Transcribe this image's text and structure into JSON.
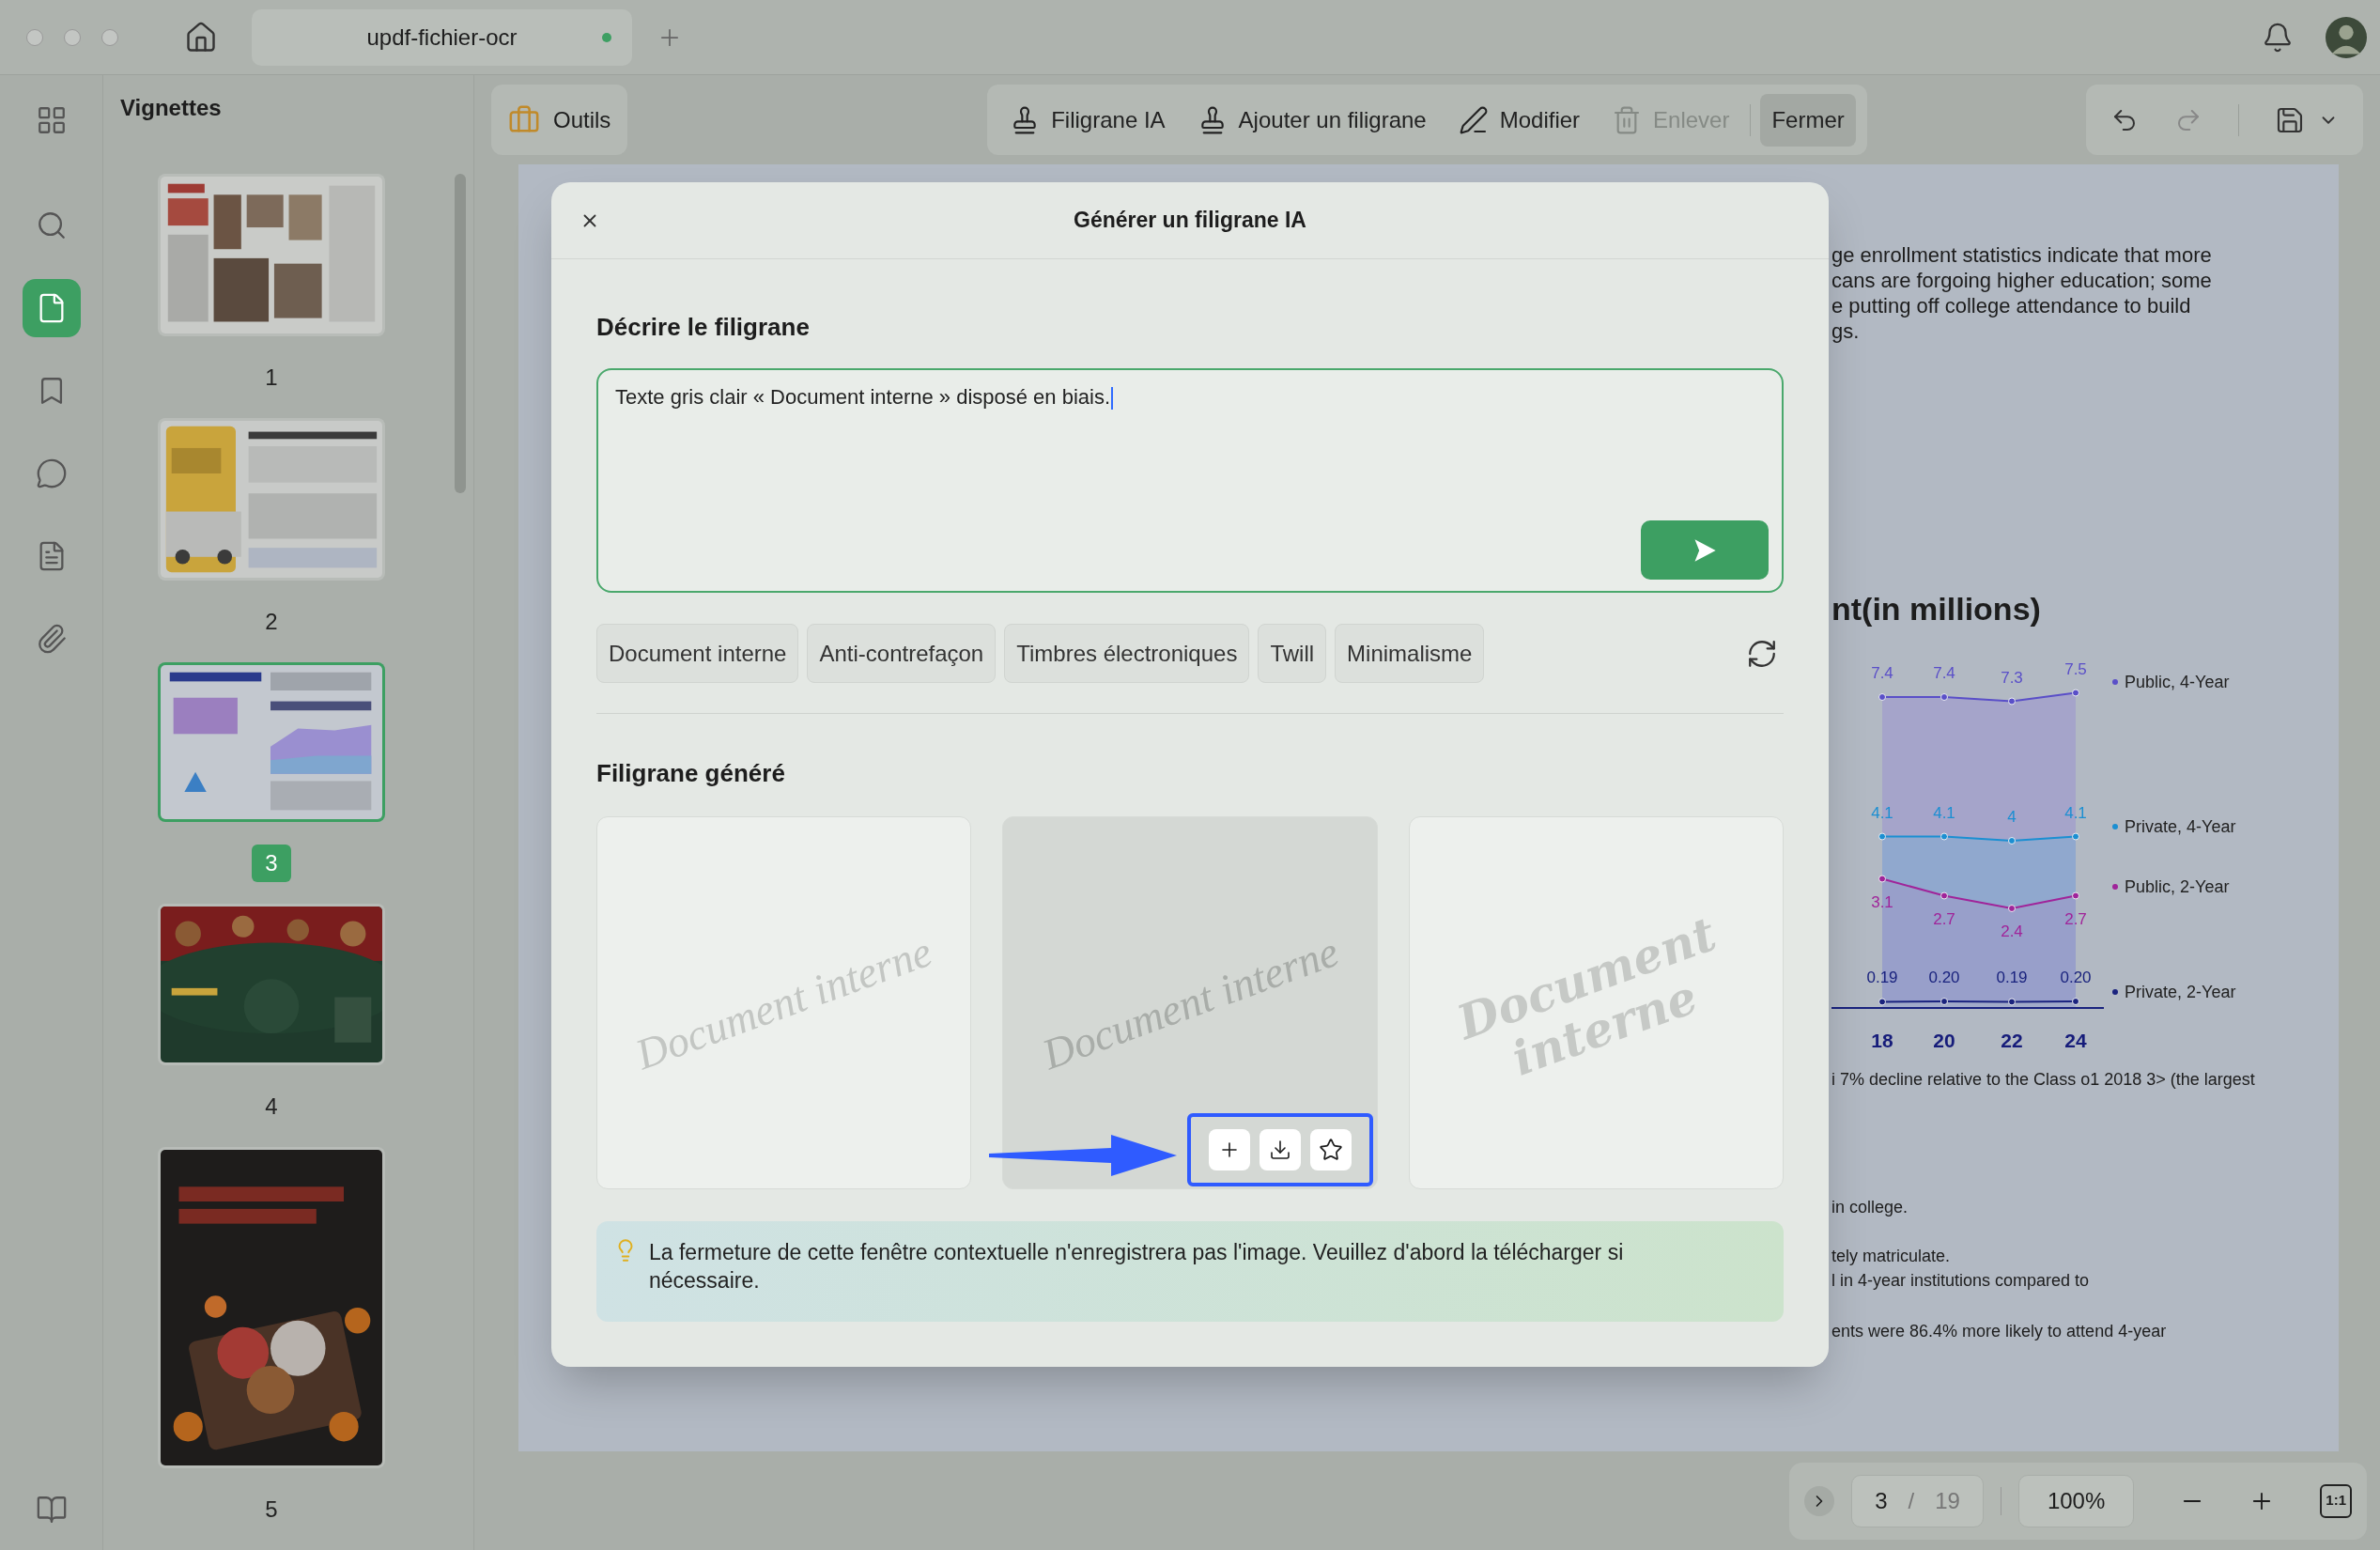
{
  "window": {
    "tab_title": "updf-fichier-ocr"
  },
  "rail": [
    {
      "selected": false
    },
    {
      "selected": false
    },
    {
      "selected": true
    },
    {
      "selected": false
    },
    {
      "selected": false
    },
    {
      "selected": false
    },
    {
      "selected": false
    },
    {
      "selected": false
    }
  ],
  "sidebar": {
    "title": "Vignettes",
    "thumbnails": [
      {
        "label": "1",
        "selected": false
      },
      {
        "label": "2",
        "selected": false
      },
      {
        "label": "3",
        "selected": true
      },
      {
        "label": "4",
        "selected": false
      },
      {
        "label": "5",
        "selected": false
      }
    ]
  },
  "toolbar": {
    "tools_button": "Outils",
    "actions": [
      {
        "label": "Filigrane IA",
        "selected": false,
        "disabled": false
      },
      {
        "label": "Ajouter un filigrane",
        "selected": false,
        "disabled": false
      },
      {
        "label": "Modifier",
        "selected": false,
        "disabled": false
      },
      {
        "label": "Enlever",
        "selected": false,
        "disabled": true
      },
      {
        "label": "Fermer",
        "selected": true,
        "disabled": false
      }
    ]
  },
  "document": {
    "intro_lines": [
      "ge enrollment statistics indicate that more",
      "cans are forgoing higher education; some",
      "e putting off college attendance to build",
      "gs."
    ],
    "heading": "nt(in millions)",
    "chart_data": {
      "type": "area",
      "categories": [
        "18",
        "20",
        "22",
        "24"
      ],
      "data_labels": true,
      "legend": true,
      "series": [
        {
          "name": "Public, 4-Year",
          "color": "#5a4fc8",
          "values": [
            7.4,
            7.4,
            7.3,
            7.5
          ],
          "value_labels": [
            "7.4",
            "7.4",
            "7.3",
            "7.5"
          ]
        },
        {
          "name": "Private, 4-Year",
          "color": "#1b8fd2",
          "values": [
            4.1,
            4.1,
            4,
            4.1
          ],
          "value_labels": [
            "4.1",
            "4.1",
            "4",
            "4.1"
          ]
        },
        {
          "name": "Public, 2-Year",
          "color": "#a0249a",
          "values": [
            3.1,
            2.7,
            2.4,
            2.7
          ],
          "value_labels": [
            "3.1",
            "2.7",
            "2.4",
            "2.7"
          ]
        },
        {
          "name": "Private, 2-Year",
          "color": "#1a237e",
          "values": [
            0.19,
            0.2,
            0.19,
            0.2
          ],
          "value_labels": [
            "0.19",
            "0.20",
            "0.19",
            "0.20"
          ]
        }
      ]
    },
    "body_lines": [
      "i 7% decline relative to the Class o1 2018 3> (the largest",
      "in college.",
      "tely matriculate.",
      "l in 4-year institutions compared to",
      "ents were 86.4% more likely to attend 4-year"
    ]
  },
  "modal": {
    "title": "Générer un filigrane IA",
    "describe_heading": "Décrire le filigrane",
    "prompt_value": "Texte gris clair « Document interne » disposé en biais.",
    "suggestions": [
      "Document interne",
      "Anti-contrefaçon",
      "Timbres électroniques",
      "Twill",
      "Minimalisme"
    ],
    "generated_heading": "Filigrane généré",
    "results": [
      {
        "text": "Document interne",
        "kind": "plain",
        "hovered": false
      },
      {
        "text": "Document interne",
        "kind": "shaded",
        "hovered": true
      },
      {
        "text": "Document interne",
        "kind": "bold",
        "hovered": false
      }
    ],
    "notice": "La fermeture de cette fenêtre contextuelle n'enregistrera pas l'image. Veuillez d'abord la télécharger si nécessaire."
  },
  "pager": {
    "current": "3",
    "separator": "/",
    "total": "19",
    "zoom": "100%",
    "actual_size": "1:1"
  }
}
